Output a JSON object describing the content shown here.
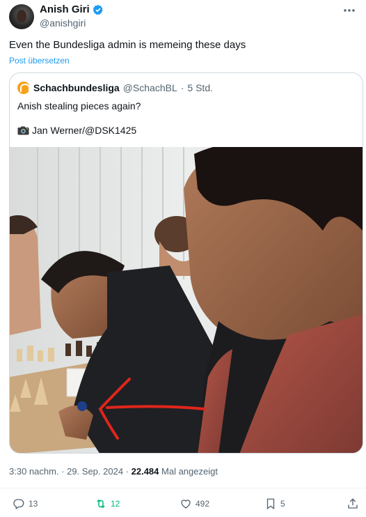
{
  "author": {
    "name": "Anish Giri",
    "handle": "@anishgiri"
  },
  "post": {
    "text": "Even the Bundesliga admin is memeing these days",
    "translate_label": "Post übersetzen"
  },
  "quoted": {
    "name": "Schachbundesliga",
    "handle": "@SchachBL",
    "separator": "·",
    "time": "5 Std.",
    "line1": "Anish stealing pieces again?",
    "line2": "Jan Werner/@DSK1425"
  },
  "meta": {
    "time": "3:30 nachm. · 29. Sep. 2024 ·",
    "views": "22.484",
    "views_label": "Mal angezeigt"
  },
  "actions": {
    "replies": "13",
    "reposts": "12",
    "likes": "492",
    "bookmarks": "5"
  },
  "colors": {
    "accent": "#1d9bf0",
    "repost": "#00ba7c",
    "arrow": "#e0261b"
  }
}
